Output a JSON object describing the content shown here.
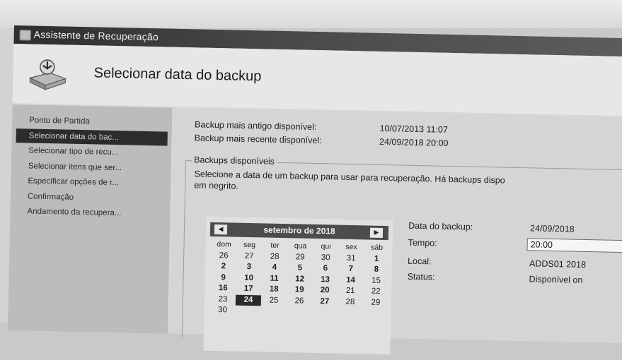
{
  "window": {
    "title": "Assistente de Recuperação"
  },
  "header": {
    "title": "Selecionar data do backup"
  },
  "nav": {
    "items": [
      {
        "label": "Ponto de Partida",
        "selected": false
      },
      {
        "label": "Selecionar data do bac...",
        "selected": true
      },
      {
        "label": "Selecionar tipo de recu...",
        "selected": false
      },
      {
        "label": "Selecionar itens que ser...",
        "selected": false
      },
      {
        "label": "Especificar opções de r...",
        "selected": false
      },
      {
        "label": "Confirmação",
        "selected": false
      },
      {
        "label": "Andamento da recupera...",
        "selected": false
      }
    ]
  },
  "info": {
    "oldest_label": "Backup mais antigo disponível:",
    "oldest_value": "10/07/2013 11:07",
    "newest_label": "Backup mais recente disponível:",
    "newest_value": "24/09/2018 20:00"
  },
  "group": {
    "legend": "Backups disponíveis",
    "description": "Selecione a data de um backup para usar para recuperação. Há backups dispo",
    "description2": "em negrito."
  },
  "calendar": {
    "month_label": "setembro de 2018",
    "prev": "◀",
    "next": "▶",
    "weekdays": [
      "dom",
      "seg",
      "ter",
      "qua",
      "qui",
      "sex",
      "sáb"
    ],
    "weeks": [
      [
        {
          "d": "26",
          "b": false
        },
        {
          "d": "27",
          "b": false
        },
        {
          "d": "28",
          "b": false
        },
        {
          "d": "29",
          "b": false
        },
        {
          "d": "30",
          "b": false
        },
        {
          "d": "31",
          "b": false
        },
        {
          "d": "1",
          "b": true
        }
      ],
      [
        {
          "d": "2",
          "b": true
        },
        {
          "d": "3",
          "b": true
        },
        {
          "d": "4",
          "b": true
        },
        {
          "d": "5",
          "b": true
        },
        {
          "d": "6",
          "b": true
        },
        {
          "d": "7",
          "b": true
        },
        {
          "d": "8",
          "b": true
        }
      ],
      [
        {
          "d": "9",
          "b": true
        },
        {
          "d": "10",
          "b": true
        },
        {
          "d": "11",
          "b": true
        },
        {
          "d": "12",
          "b": true
        },
        {
          "d": "13",
          "b": true
        },
        {
          "d": "14",
          "b": true
        },
        {
          "d": "15",
          "b": false
        }
      ],
      [
        {
          "d": "16",
          "b": true
        },
        {
          "d": "17",
          "b": true
        },
        {
          "d": "18",
          "b": true
        },
        {
          "d": "19",
          "b": true
        },
        {
          "d": "20",
          "b": true
        },
        {
          "d": "21",
          "b": false
        },
        {
          "d": "22",
          "b": false
        }
      ],
      [
        {
          "d": "23",
          "b": false
        },
        {
          "d": "24",
          "b": true,
          "sel": true
        },
        {
          "d": "25",
          "b": false
        },
        {
          "d": "26",
          "b": false
        },
        {
          "d": "27",
          "b": true
        },
        {
          "d": "28",
          "b": false
        },
        {
          "d": "29",
          "b": false
        }
      ],
      [
        {
          "d": "30",
          "b": false
        }
      ]
    ]
  },
  "details": {
    "date_label": "Data do backup:",
    "date_value": "24/09/2018",
    "time_label": "Tempo:",
    "time_value": "20:00",
    "location_label": "Local:",
    "location_value": "ADDS01 2018",
    "status_label": "Status:",
    "status_value": "Disponível on"
  }
}
